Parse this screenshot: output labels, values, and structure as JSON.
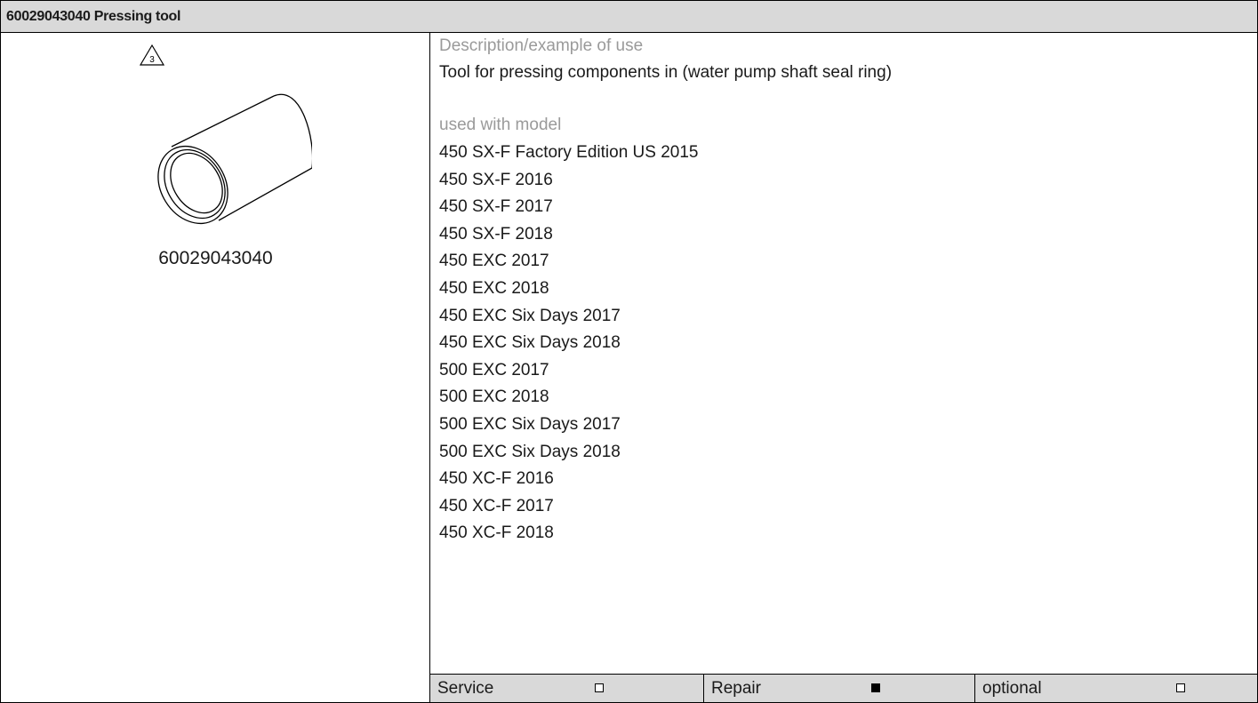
{
  "header": {
    "title": "60029043040 Pressing tool"
  },
  "left": {
    "warning_number": "3",
    "part_number": "60029043040"
  },
  "description": {
    "label": "Description/example of use",
    "text": "Tool for pressing components in (water pump shaft seal ring)"
  },
  "models": {
    "label": "used with model",
    "items": [
      "450 SX-F Factory Edition US 2015",
      "450 SX-F 2016",
      "450 SX-F 2017",
      "450 SX-F 2018",
      "450 EXC 2017",
      "450 EXC 2018",
      "450 EXC Six Days 2017",
      "450 EXC Six Days 2018",
      "500 EXC 2017",
      "500 EXC 2018",
      "500 EXC Six Days 2017",
      "500 EXC Six Days 2018",
      "450 XC-F 2016",
      "450 XC-F 2017",
      "450 XC-F 2018"
    ]
  },
  "footer": {
    "service": {
      "label": "Service",
      "checked": false
    },
    "repair": {
      "label": "Repair",
      "checked": true
    },
    "optional": {
      "label": "optional",
      "checked": false
    }
  }
}
